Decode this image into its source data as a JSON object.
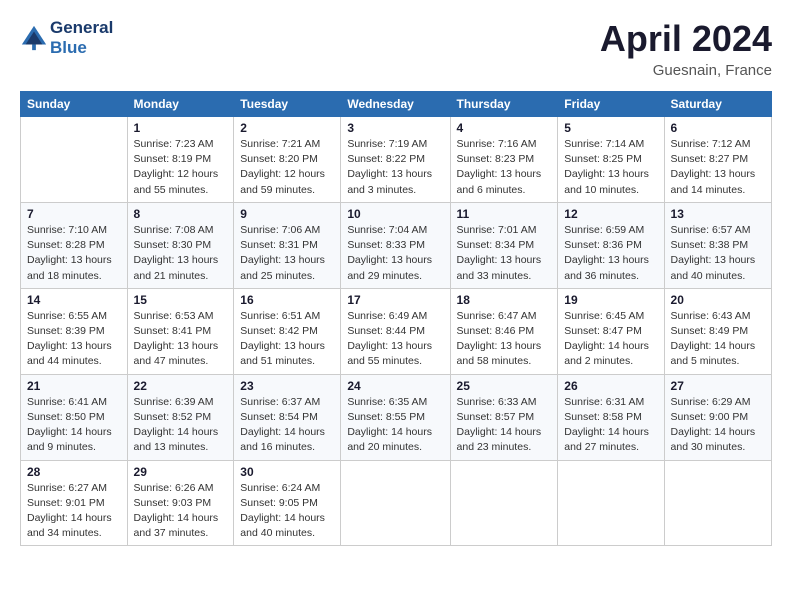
{
  "header": {
    "logo_line1": "General",
    "logo_line2": "Blue",
    "title": "April 2024",
    "location": "Guesnain, France"
  },
  "columns": [
    "Sunday",
    "Monday",
    "Tuesday",
    "Wednesday",
    "Thursday",
    "Friday",
    "Saturday"
  ],
  "weeks": [
    [
      {
        "day": "",
        "info": ""
      },
      {
        "day": "1",
        "info": "Sunrise: 7:23 AM\nSunset: 8:19 PM\nDaylight: 12 hours\nand 55 minutes."
      },
      {
        "day": "2",
        "info": "Sunrise: 7:21 AM\nSunset: 8:20 PM\nDaylight: 12 hours\nand 59 minutes."
      },
      {
        "day": "3",
        "info": "Sunrise: 7:19 AM\nSunset: 8:22 PM\nDaylight: 13 hours\nand 3 minutes."
      },
      {
        "day": "4",
        "info": "Sunrise: 7:16 AM\nSunset: 8:23 PM\nDaylight: 13 hours\nand 6 minutes."
      },
      {
        "day": "5",
        "info": "Sunrise: 7:14 AM\nSunset: 8:25 PM\nDaylight: 13 hours\nand 10 minutes."
      },
      {
        "day": "6",
        "info": "Sunrise: 7:12 AM\nSunset: 8:27 PM\nDaylight: 13 hours\nand 14 minutes."
      }
    ],
    [
      {
        "day": "7",
        "info": "Sunrise: 7:10 AM\nSunset: 8:28 PM\nDaylight: 13 hours\nand 18 minutes."
      },
      {
        "day": "8",
        "info": "Sunrise: 7:08 AM\nSunset: 8:30 PM\nDaylight: 13 hours\nand 21 minutes."
      },
      {
        "day": "9",
        "info": "Sunrise: 7:06 AM\nSunset: 8:31 PM\nDaylight: 13 hours\nand 25 minutes."
      },
      {
        "day": "10",
        "info": "Sunrise: 7:04 AM\nSunset: 8:33 PM\nDaylight: 13 hours\nand 29 minutes."
      },
      {
        "day": "11",
        "info": "Sunrise: 7:01 AM\nSunset: 8:34 PM\nDaylight: 13 hours\nand 33 minutes."
      },
      {
        "day": "12",
        "info": "Sunrise: 6:59 AM\nSunset: 8:36 PM\nDaylight: 13 hours\nand 36 minutes."
      },
      {
        "day": "13",
        "info": "Sunrise: 6:57 AM\nSunset: 8:38 PM\nDaylight: 13 hours\nand 40 minutes."
      }
    ],
    [
      {
        "day": "14",
        "info": "Sunrise: 6:55 AM\nSunset: 8:39 PM\nDaylight: 13 hours\nand 44 minutes."
      },
      {
        "day": "15",
        "info": "Sunrise: 6:53 AM\nSunset: 8:41 PM\nDaylight: 13 hours\nand 47 minutes."
      },
      {
        "day": "16",
        "info": "Sunrise: 6:51 AM\nSunset: 8:42 PM\nDaylight: 13 hours\nand 51 minutes."
      },
      {
        "day": "17",
        "info": "Sunrise: 6:49 AM\nSunset: 8:44 PM\nDaylight: 13 hours\nand 55 minutes."
      },
      {
        "day": "18",
        "info": "Sunrise: 6:47 AM\nSunset: 8:46 PM\nDaylight: 13 hours\nand 58 minutes."
      },
      {
        "day": "19",
        "info": "Sunrise: 6:45 AM\nSunset: 8:47 PM\nDaylight: 14 hours\nand 2 minutes."
      },
      {
        "day": "20",
        "info": "Sunrise: 6:43 AM\nSunset: 8:49 PM\nDaylight: 14 hours\nand 5 minutes."
      }
    ],
    [
      {
        "day": "21",
        "info": "Sunrise: 6:41 AM\nSunset: 8:50 PM\nDaylight: 14 hours\nand 9 minutes."
      },
      {
        "day": "22",
        "info": "Sunrise: 6:39 AM\nSunset: 8:52 PM\nDaylight: 14 hours\nand 13 minutes."
      },
      {
        "day": "23",
        "info": "Sunrise: 6:37 AM\nSunset: 8:54 PM\nDaylight: 14 hours\nand 16 minutes."
      },
      {
        "day": "24",
        "info": "Sunrise: 6:35 AM\nSunset: 8:55 PM\nDaylight: 14 hours\nand 20 minutes."
      },
      {
        "day": "25",
        "info": "Sunrise: 6:33 AM\nSunset: 8:57 PM\nDaylight: 14 hours\nand 23 minutes."
      },
      {
        "day": "26",
        "info": "Sunrise: 6:31 AM\nSunset: 8:58 PM\nDaylight: 14 hours\nand 27 minutes."
      },
      {
        "day": "27",
        "info": "Sunrise: 6:29 AM\nSunset: 9:00 PM\nDaylight: 14 hours\nand 30 minutes."
      }
    ],
    [
      {
        "day": "28",
        "info": "Sunrise: 6:27 AM\nSunset: 9:01 PM\nDaylight: 14 hours\nand 34 minutes."
      },
      {
        "day": "29",
        "info": "Sunrise: 6:26 AM\nSunset: 9:03 PM\nDaylight: 14 hours\nand 37 minutes."
      },
      {
        "day": "30",
        "info": "Sunrise: 6:24 AM\nSunset: 9:05 PM\nDaylight: 14 hours\nand 40 minutes."
      },
      {
        "day": "",
        "info": ""
      },
      {
        "day": "",
        "info": ""
      },
      {
        "day": "",
        "info": ""
      },
      {
        "day": "",
        "info": ""
      }
    ]
  ]
}
